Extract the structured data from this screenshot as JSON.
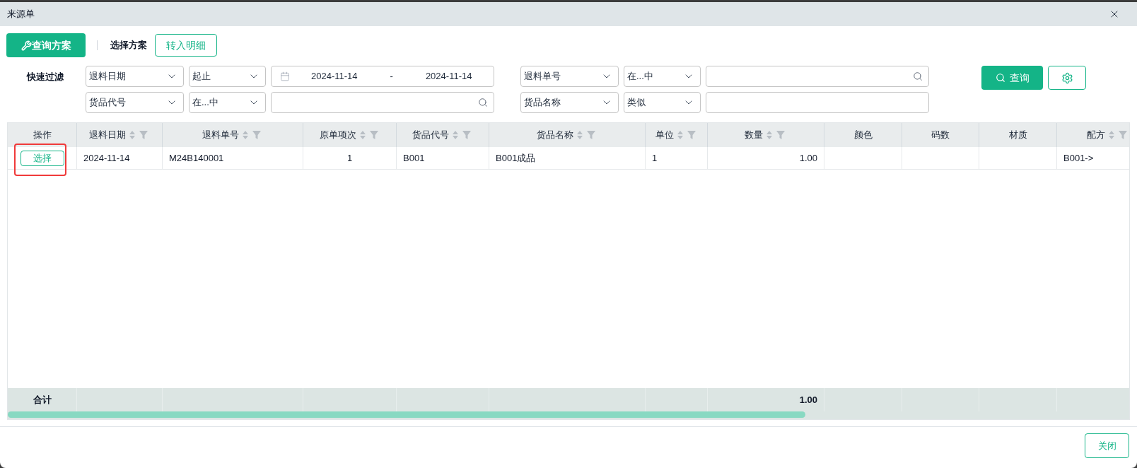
{
  "window": {
    "title": "来源单"
  },
  "toolbar": {
    "scheme_button": "查询方案",
    "scheme_label": "选择方案",
    "transfer_button": "转入明细"
  },
  "quick_filter": {
    "label": "快速过滤",
    "filters": [
      {
        "field": "退料日期",
        "operator": "起止",
        "kind": "date_range",
        "from": "2024-11-14",
        "separator": "-",
        "to": "2024-11-14"
      },
      {
        "field": "退料单号",
        "operator": "在...中",
        "kind": "search"
      },
      {
        "field": "货品代号",
        "operator": "在...中",
        "kind": "search"
      },
      {
        "field": "货品名称",
        "operator": "类似",
        "kind": "text"
      }
    ],
    "query_button": "查询"
  },
  "table": {
    "columns": [
      {
        "label": "操作",
        "sortable": false
      },
      {
        "label": "退料日期",
        "sortable": true
      },
      {
        "label": "退料单号",
        "sortable": true
      },
      {
        "label": "原单项次",
        "sortable": true
      },
      {
        "label": "货品代号",
        "sortable": true
      },
      {
        "label": "货品名称",
        "sortable": true
      },
      {
        "label": "单位",
        "sortable": true
      },
      {
        "label": "数量",
        "sortable": true
      },
      {
        "label": "颜色",
        "sortable": false
      },
      {
        "label": "码数",
        "sortable": false
      },
      {
        "label": "材质",
        "sortable": false
      },
      {
        "label": "配方",
        "sortable": true
      }
    ],
    "rows": [
      {
        "annotated": true,
        "cells": [
          "选择",
          "2024-11-14",
          "M24B140001",
          "1",
          "B001",
          "B001成品",
          "1",
          "1.00",
          "",
          "",
          "",
          "B001->"
        ]
      }
    ],
    "footer": {
      "cells": [
        "合计",
        "",
        "",
        "",
        "",
        "",
        "",
        "1.00",
        "",
        "",
        "",
        ""
      ]
    }
  },
  "close_button": "关闭"
}
